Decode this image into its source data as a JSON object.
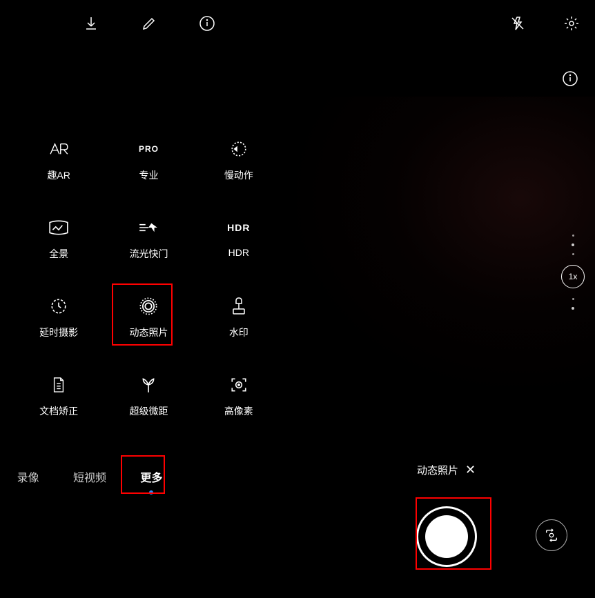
{
  "left": {
    "top_icons": [
      "download",
      "edit",
      "info"
    ],
    "modes": [
      {
        "id": "ar",
        "label": "趣AR"
      },
      {
        "id": "pro",
        "label": "专业"
      },
      {
        "id": "slowmo",
        "label": "慢动作"
      },
      {
        "id": "panorama",
        "label": "全景"
      },
      {
        "id": "lightpainting",
        "label": "流光快门"
      },
      {
        "id": "hdr",
        "label": "HDR"
      },
      {
        "id": "timelapse",
        "label": "延时摄影"
      },
      {
        "id": "livephoto",
        "label": "动态照片"
      },
      {
        "id": "watermark",
        "label": "水印"
      },
      {
        "id": "docscan",
        "label": "文档矫正"
      },
      {
        "id": "supermacro",
        "label": "超级微距"
      },
      {
        "id": "highres",
        "label": "高像素"
      }
    ],
    "nav": {
      "items": [
        {
          "label": "录像",
          "active": false
        },
        {
          "label": "短视频",
          "active": false
        },
        {
          "label": "更多",
          "active": true
        }
      ]
    }
  },
  "right": {
    "top_icons": [
      "flash-off",
      "settings"
    ],
    "zoom": "1x",
    "mode_indicator": "动态照片",
    "mode_close": "✕"
  },
  "icons": {
    "pro_text": "PRO",
    "hdr_text": "HDR",
    "hdr_label": "HDR"
  }
}
